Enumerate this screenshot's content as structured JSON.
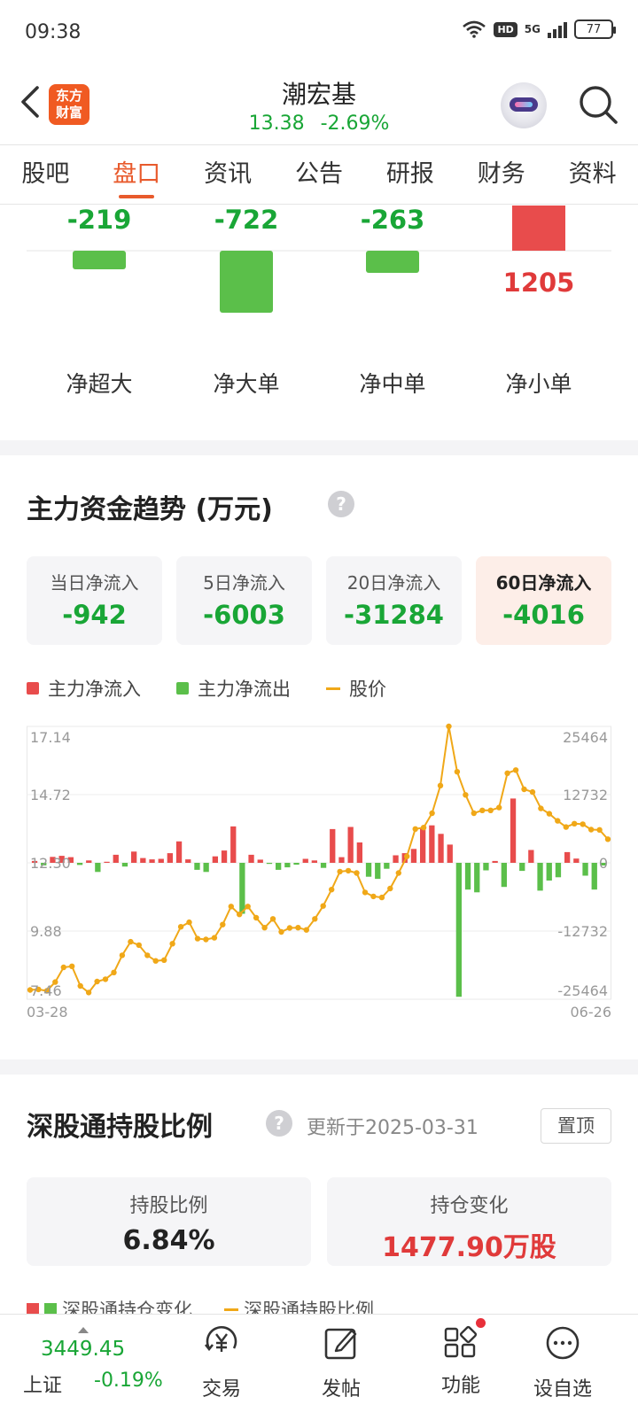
{
  "status_bar": {
    "time": "09:38",
    "hd": "HD",
    "network": "5G",
    "battery": "77"
  },
  "header": {
    "logo_line1": "东方",
    "logo_line2": "财富",
    "stock_name": "潮宏基",
    "price": "13.38",
    "change_pct": "-2.69%"
  },
  "tabs": [
    {
      "label": "股吧"
    },
    {
      "label": "盘口"
    },
    {
      "label": "资讯"
    },
    {
      "label": "公告"
    },
    {
      "label": "研报"
    },
    {
      "label": "财务"
    },
    {
      "label": "资料"
    }
  ],
  "net_flow": {
    "items": [
      {
        "label": "净超大",
        "value": -219,
        "value_text": "-219"
      },
      {
        "label": "净大单",
        "value": -722,
        "value_text": "-722"
      },
      {
        "label": "净中单",
        "value": -263,
        "value_text": "-263"
      },
      {
        "label": "净小单",
        "value": 1205,
        "value_text": "1205"
      }
    ]
  },
  "trend": {
    "title": "主力资金趋势 (万元)",
    "help": "?",
    "cards": [
      {
        "label": "当日净流入",
        "value": "-942"
      },
      {
        "label": "5日净流入",
        "value": "-6003"
      },
      {
        "label": "20日净流入",
        "value": "-31284"
      },
      {
        "label": "60日净流入",
        "value": "-4016"
      }
    ],
    "legend": {
      "inflow": "主力净流入",
      "outflow": "主力净流出",
      "price": "股价"
    }
  },
  "chart_data": {
    "type": "bar",
    "x_start_label": "03-28",
    "x_end_label": "06-26",
    "left_axis_ticks": [
      "17.14",
      "14.72",
      "12.30",
      "9.88",
      "7.46"
    ],
    "right_axis_ticks": [
      "25464",
      "12732",
      "0",
      "-12732",
      "-25464"
    ],
    "price_range": [
      7.46,
      17.14
    ],
    "flow_range": [
      -25464,
      25464
    ],
    "series": [
      {
        "name": "主力资金",
        "values": [
          350,
          -480,
          1100,
          1300,
          1050,
          -400,
          450,
          -1700,
          200,
          1500,
          -700,
          2100,
          900,
          650,
          750,
          1800,
          4000,
          650,
          -1300,
          -1700,
          1200,
          2300,
          6800,
          -9500,
          1500,
          600,
          -200,
          -1300,
          -850,
          -350,
          750,
          450,
          -950,
          6300,
          1050,
          6700,
          3800,
          -2600,
          -3000,
          -1100,
          1400,
          1800,
          2600,
          6500,
          7000,
          5400,
          3400,
          -25000,
          -5000,
          -5500,
          -1400,
          350,
          -4500,
          12000,
          -1500,
          2400,
          -5200,
          -3300,
          -2700,
          2000,
          800,
          -2400,
          -5000,
          -500
        ],
        "colors": {
          "positive": "#e84c4c",
          "negative": "#5bbf4a"
        }
      },
      {
        "name": "股价",
        "values": [
          7.79,
          7.81,
          7.76,
          8.07,
          8.59,
          8.63,
          7.93,
          7.7,
          8.09,
          8.17,
          8.41,
          9.02,
          9.5,
          9.38,
          9.02,
          8.82,
          8.85,
          9.43,
          10.03,
          10.19,
          9.61,
          9.58,
          9.64,
          10.11,
          10.75,
          10.47,
          10.75,
          10.35,
          10.0,
          10.31,
          9.85,
          9.99,
          10.0,
          9.92,
          10.31,
          10.77,
          11.35,
          11.99,
          12.02,
          11.94,
          11.25,
          11.11,
          11.07,
          11.39,
          11.94,
          12.53,
          13.5,
          13.55,
          14.06,
          15.04,
          17.14,
          15.53,
          14.71,
          14.06,
          14.16,
          14.16,
          14.26,
          15.48,
          15.59,
          14.91,
          14.81,
          14.23,
          14.04,
          13.79,
          13.57,
          13.69,
          13.67,
          13.48,
          13.47,
          13.14
        ]
      }
    ]
  },
  "hk_connect": {
    "title": "深股通持股比例",
    "help": "?",
    "update": "更新于2025-03-31",
    "pin": "置顶",
    "cards": [
      {
        "label": "持股比例",
        "value": "6.84%"
      },
      {
        "label": "持仓变化",
        "value": "1477.90万股"
      }
    ],
    "legend": {
      "change": "深股通持仓变化",
      "ratio": "深股通持股比例"
    }
  },
  "bottom_bar": {
    "index_value": "3449.45",
    "index_name": "上证",
    "index_change": "-0.19%",
    "items": [
      {
        "label": "交易",
        "icon": "yen-icon"
      },
      {
        "label": "发帖",
        "icon": "edit-icon"
      },
      {
        "label": "功能",
        "icon": "grid-icon"
      },
      {
        "label": "设自选",
        "icon": "more-icon"
      }
    ]
  },
  "colors": {
    "red": "#e84c4c",
    "green": "#5bbf4a",
    "price_line": "#f0a818",
    "accent": "#e85a2c"
  }
}
